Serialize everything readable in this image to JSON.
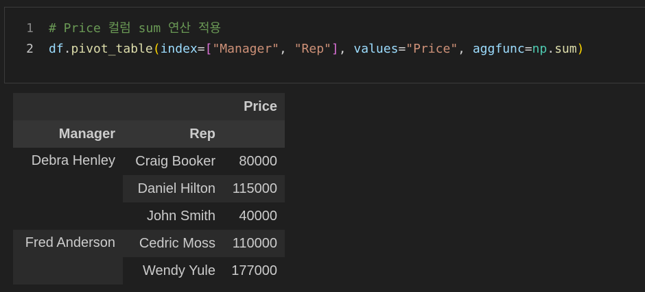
{
  "code_cell": {
    "lines": [
      {
        "number": "1",
        "comment": "# Price 컬럼 sum 연산 적용"
      },
      {
        "number": "2",
        "tokens": {
          "df": "df",
          "dot1": ".",
          "func": "pivot_table",
          "open_paren": "(",
          "index_kw": "index",
          "eq1": "=",
          "open_bracket": "[",
          "str_manager": "\"Manager\"",
          "comma1": ", ",
          "str_rep": "\"Rep\"",
          "close_bracket": "]",
          "comma2": ", ",
          "values_kw": "values",
          "eq2": "=",
          "str_price": "\"Price\"",
          "comma3": ", ",
          "aggfunc_kw": "aggfunc",
          "eq3": "=",
          "np": "np",
          "dot2": ".",
          "sum": "sum",
          "close_paren": ")"
        }
      }
    ]
  },
  "output_table": {
    "column_header": "Price",
    "index_headers": [
      "Manager",
      "Rep"
    ],
    "groups": [
      {
        "manager": "Debra Henley",
        "rows": [
          {
            "rep": "Craig Booker",
            "price": "80000"
          },
          {
            "rep": "Daniel Hilton",
            "price": "115000"
          },
          {
            "rep": "John Smith",
            "price": "40000"
          }
        ]
      },
      {
        "manager": "Fred Anderson",
        "rows": [
          {
            "rep": "Cedric Moss",
            "price": "110000"
          },
          {
            "rep": "Wendy Yule",
            "price": "177000"
          }
        ]
      }
    ]
  },
  "colors": {
    "background": "#1f1f1f",
    "comment": "#6a9955",
    "variable": "#9cdcfe",
    "function": "#dcdcaa",
    "string": "#ce9178",
    "paren": "#ffd700",
    "bracket": "#da70d6"
  }
}
